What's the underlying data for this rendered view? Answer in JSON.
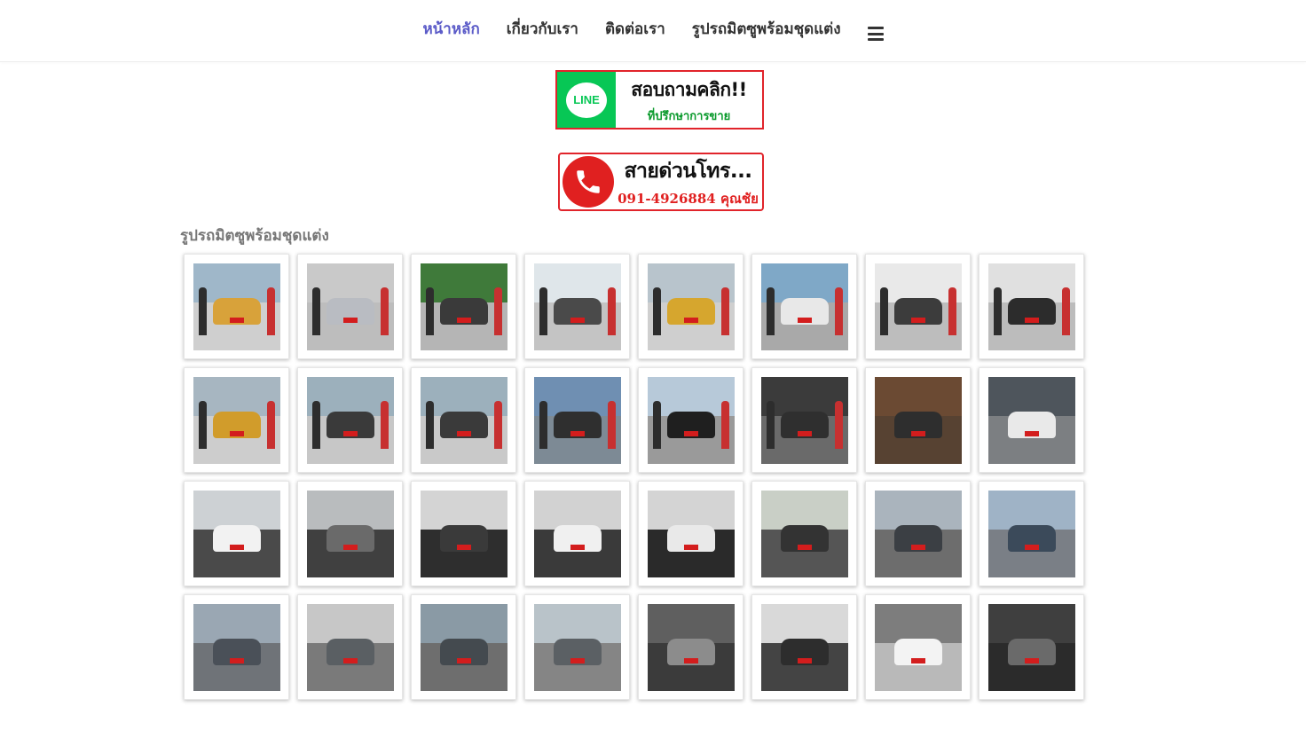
{
  "nav": {
    "items": [
      {
        "label": "หน้าหลัก",
        "active": true
      },
      {
        "label": "เกี่ยวกับเรา",
        "active": false
      },
      {
        "label": "ติดต่อเรา",
        "active": false
      },
      {
        "label": "รูปรถมิตซูพร้อมชุดแต่ง",
        "active": false
      }
    ],
    "menu_icon": "hamburger-menu-icon"
  },
  "line_banner": {
    "logo_text": "LINE",
    "main": "สอบถามคลิก!!",
    "sub": "ที่ปรึกษาการขาย"
  },
  "call_banner": {
    "main": "สายด่วนโทร...",
    "sub": "091-4926884 คุณชัย"
  },
  "gallery": {
    "title": "รูปรถมิตซูพร้อมชุดแต่ง",
    "rows": 4,
    "columns": 8
  },
  "colors": {
    "nav_active": "#5b5bc8",
    "line_green": "#07c755",
    "banner_red": "#e1242b"
  }
}
